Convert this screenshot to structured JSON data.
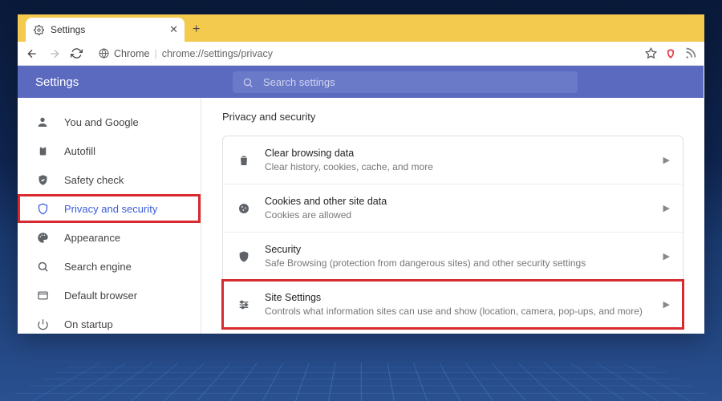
{
  "tab": {
    "title": "Settings"
  },
  "address": {
    "prefix": "Chrome",
    "url": "chrome://settings/privacy"
  },
  "header": {
    "title": "Settings"
  },
  "search": {
    "placeholder": "Search settings"
  },
  "sidebar": {
    "items": [
      {
        "label": "You and Google"
      },
      {
        "label": "Autofill"
      },
      {
        "label": "Safety check"
      },
      {
        "label": "Privacy and security"
      },
      {
        "label": "Appearance"
      },
      {
        "label": "Search engine"
      },
      {
        "label": "Default browser"
      },
      {
        "label": "On startup"
      }
    ]
  },
  "main": {
    "section_title": "Privacy and security",
    "rows": [
      {
        "title": "Clear browsing data",
        "sub": "Clear history, cookies, cache, and more"
      },
      {
        "title": "Cookies and other site data",
        "sub": "Cookies are allowed"
      },
      {
        "title": "Security",
        "sub": "Safe Browsing (protection from dangerous sites) and other security settings"
      },
      {
        "title": "Site Settings",
        "sub": "Controls what information sites can use and show (location, camera, pop-ups, and more)"
      }
    ]
  }
}
